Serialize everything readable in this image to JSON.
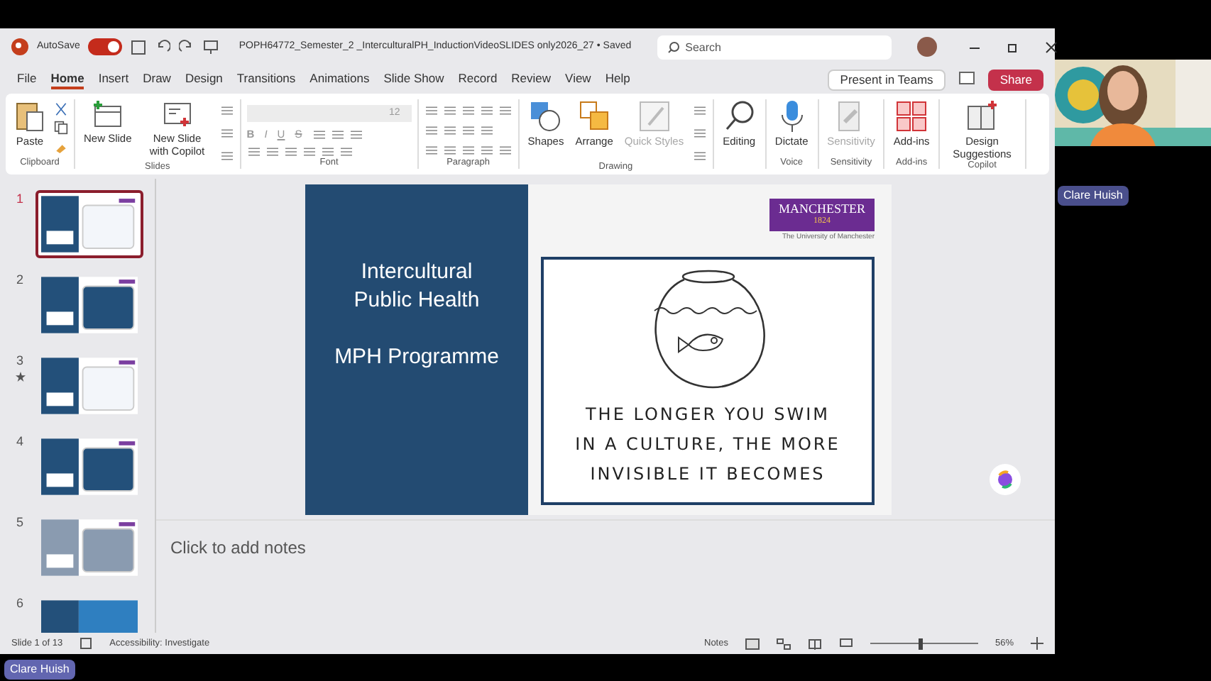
{
  "title_bar": {
    "autosave_label": "AutoSave",
    "autosave_on": true,
    "document_title": "POPH64772_Semester_2 _InterculturalPH_InductionVideoSLIDES only2026_27 • Saved",
    "search": {
      "placeholder": "Search"
    }
  },
  "menu_tabs": [
    {
      "label": "File",
      "selected": false
    },
    {
      "label": "Home",
      "selected": true
    },
    {
      "label": "Insert",
      "selected": false
    },
    {
      "label": "Draw",
      "selected": false
    },
    {
      "label": "Design",
      "selected": false
    },
    {
      "label": "Transitions",
      "selected": false
    },
    {
      "label": "Animations",
      "selected": false
    },
    {
      "label": "Slide Show",
      "selected": false
    },
    {
      "label": "Record",
      "selected": false
    },
    {
      "label": "Review",
      "selected": false
    },
    {
      "label": "View",
      "selected": false
    },
    {
      "label": "Help",
      "selected": false
    }
  ],
  "present_button": "Present in Teams",
  "share_button": "Share",
  "ribbon": [
    {
      "kind": "clipboard",
      "label": "Clipboard",
      "buttons": [
        {
          "label": "Paste",
          "disabled": false
        }
      ]
    },
    {
      "kind": "slides",
      "label": "Slides",
      "buttons": [
        {
          "label": "New Slide",
          "disabled": false
        },
        {
          "label": "New Slide with Copilot",
          "disabled": false
        }
      ]
    },
    {
      "kind": "font",
      "label": "Font",
      "font_size": "12",
      "format_buttons": [
        "B",
        "I",
        "U",
        "S"
      ]
    },
    {
      "kind": "paragraph",
      "label": "Paragraph"
    },
    {
      "kind": "drawing",
      "label": "Drawing",
      "buttons": [
        {
          "label": "Shapes",
          "disabled": false
        },
        {
          "label": "Arrange",
          "disabled": false
        },
        {
          "label": "Quick Styles",
          "disabled": true
        }
      ]
    },
    {
      "kind": "editing",
      "buttons": [
        {
          "label": "Editing",
          "disabled": false
        }
      ]
    },
    {
      "kind": "voice",
      "label": "Voice",
      "buttons": [
        {
          "label": "Dictate",
          "disabled": false
        }
      ]
    },
    {
      "kind": "sensitivity",
      "label": "Sensitivity",
      "buttons": [
        {
          "label": "Sensitivity",
          "disabled": true
        }
      ]
    },
    {
      "kind": "addins",
      "label": "Add-ins",
      "buttons": [
        {
          "label": "Add-ins",
          "disabled": false
        }
      ]
    },
    {
      "kind": "copilot",
      "label": "Copilot",
      "buttons": [
        {
          "label": "Design Suggestions",
          "disabled": false
        }
      ]
    }
  ],
  "thumbnails": [
    {
      "number": "1",
      "selected": true,
      "animated": false
    },
    {
      "number": "2",
      "selected": false,
      "animated": false
    },
    {
      "number": "3",
      "selected": false,
      "animated": true
    },
    {
      "number": "4",
      "selected": false,
      "animated": false
    },
    {
      "number": "5",
      "selected": false,
      "animated": false
    },
    {
      "number": "6",
      "selected": false,
      "animated": false
    }
  ],
  "slide": {
    "title_lines": [
      "Intercultural",
      "Public Health"
    ],
    "subtitle": "MPH Programme",
    "logo": {
      "name": "MANCHESTER",
      "year": "1824",
      "caption": "The University of Manchester"
    },
    "quote_lines": [
      "THE LONGER YOU SWIM",
      "IN A CULTURE, THE MORE",
      "INVISIBLE IT BECOMES"
    ]
  },
  "notes": {
    "placeholder": "Click to add notes"
  },
  "status_bar": {
    "slide_counter": "Slide 1 of 13",
    "accessibility": "Accessibility: Investigate",
    "notes_button": "Notes",
    "zoom": {
      "level": 0.45,
      "reading": "56%"
    }
  },
  "participants": [
    {
      "name": "Clare Huish"
    },
    {
      "name": "Clare Huish"
    }
  ]
}
